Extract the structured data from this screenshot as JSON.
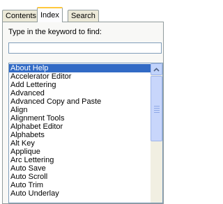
{
  "tabs": [
    {
      "label": "Contents"
    },
    {
      "label": "Index"
    },
    {
      "label": "Search"
    }
  ],
  "active_tab": "Index",
  "index": {
    "instruction": "Type in the keyword to find:",
    "keyword_value": "",
    "selected_item": "About Help",
    "items": [
      "About Help",
      "Accelerator Editor",
      "Add Lettering",
      "Advanced",
      "Advanced Copy and Paste",
      "Align",
      "Alignment Tools",
      "Alphabet Editor",
      "Alphabets",
      "Alt Key",
      "Applique",
      "Arc Lettering",
      "Auto Save",
      "Auto Scroll",
      "Auto Trim",
      "Auto Underlay"
    ]
  }
}
